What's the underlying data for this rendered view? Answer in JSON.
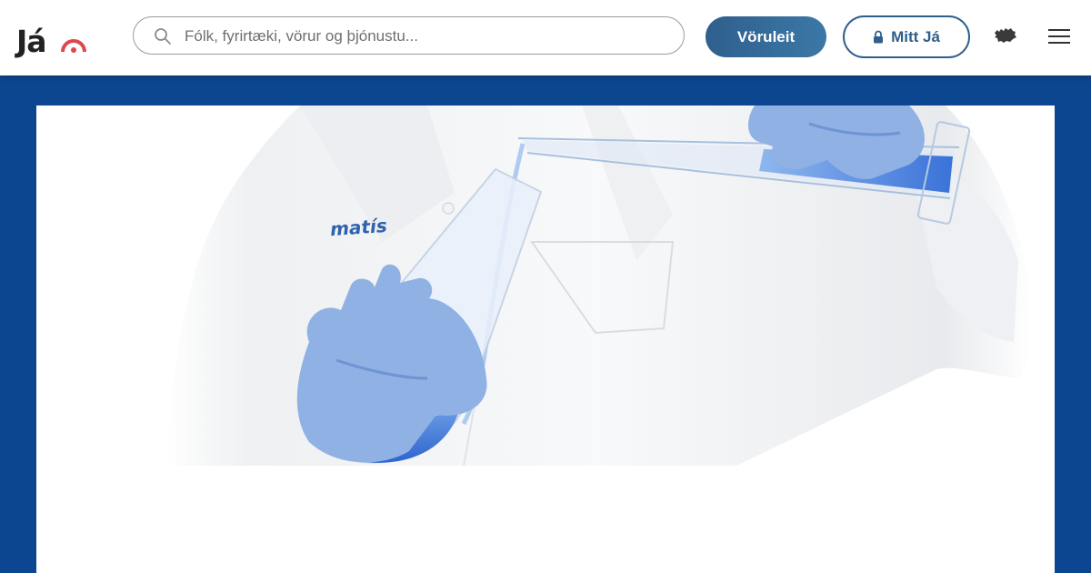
{
  "header": {
    "logo": {
      "text": "Já",
      "icon": "ja-signal-icon",
      "accent": "#e0474c"
    },
    "search": {
      "placeholder": "Fólk, fyrirtæki, vörur og þjónustu...",
      "value": "",
      "icon": "search-icon"
    },
    "voruleit_label": "Vöruleit",
    "mitt_ja_label": "Mitt Já",
    "mitt_ja_icon": "lock-icon",
    "language_icon": "iceland-icon",
    "menu_icon": "hamburger-menu-icon"
  },
  "hero": {
    "brand_text": "matís",
    "image_subject": "lab-coat-scientist-pouring-blue-liquid"
  },
  "colors": {
    "page_background": "#0d4690",
    "primary_button": "#2f5f8d",
    "logo_accent": "#e0474c"
  }
}
